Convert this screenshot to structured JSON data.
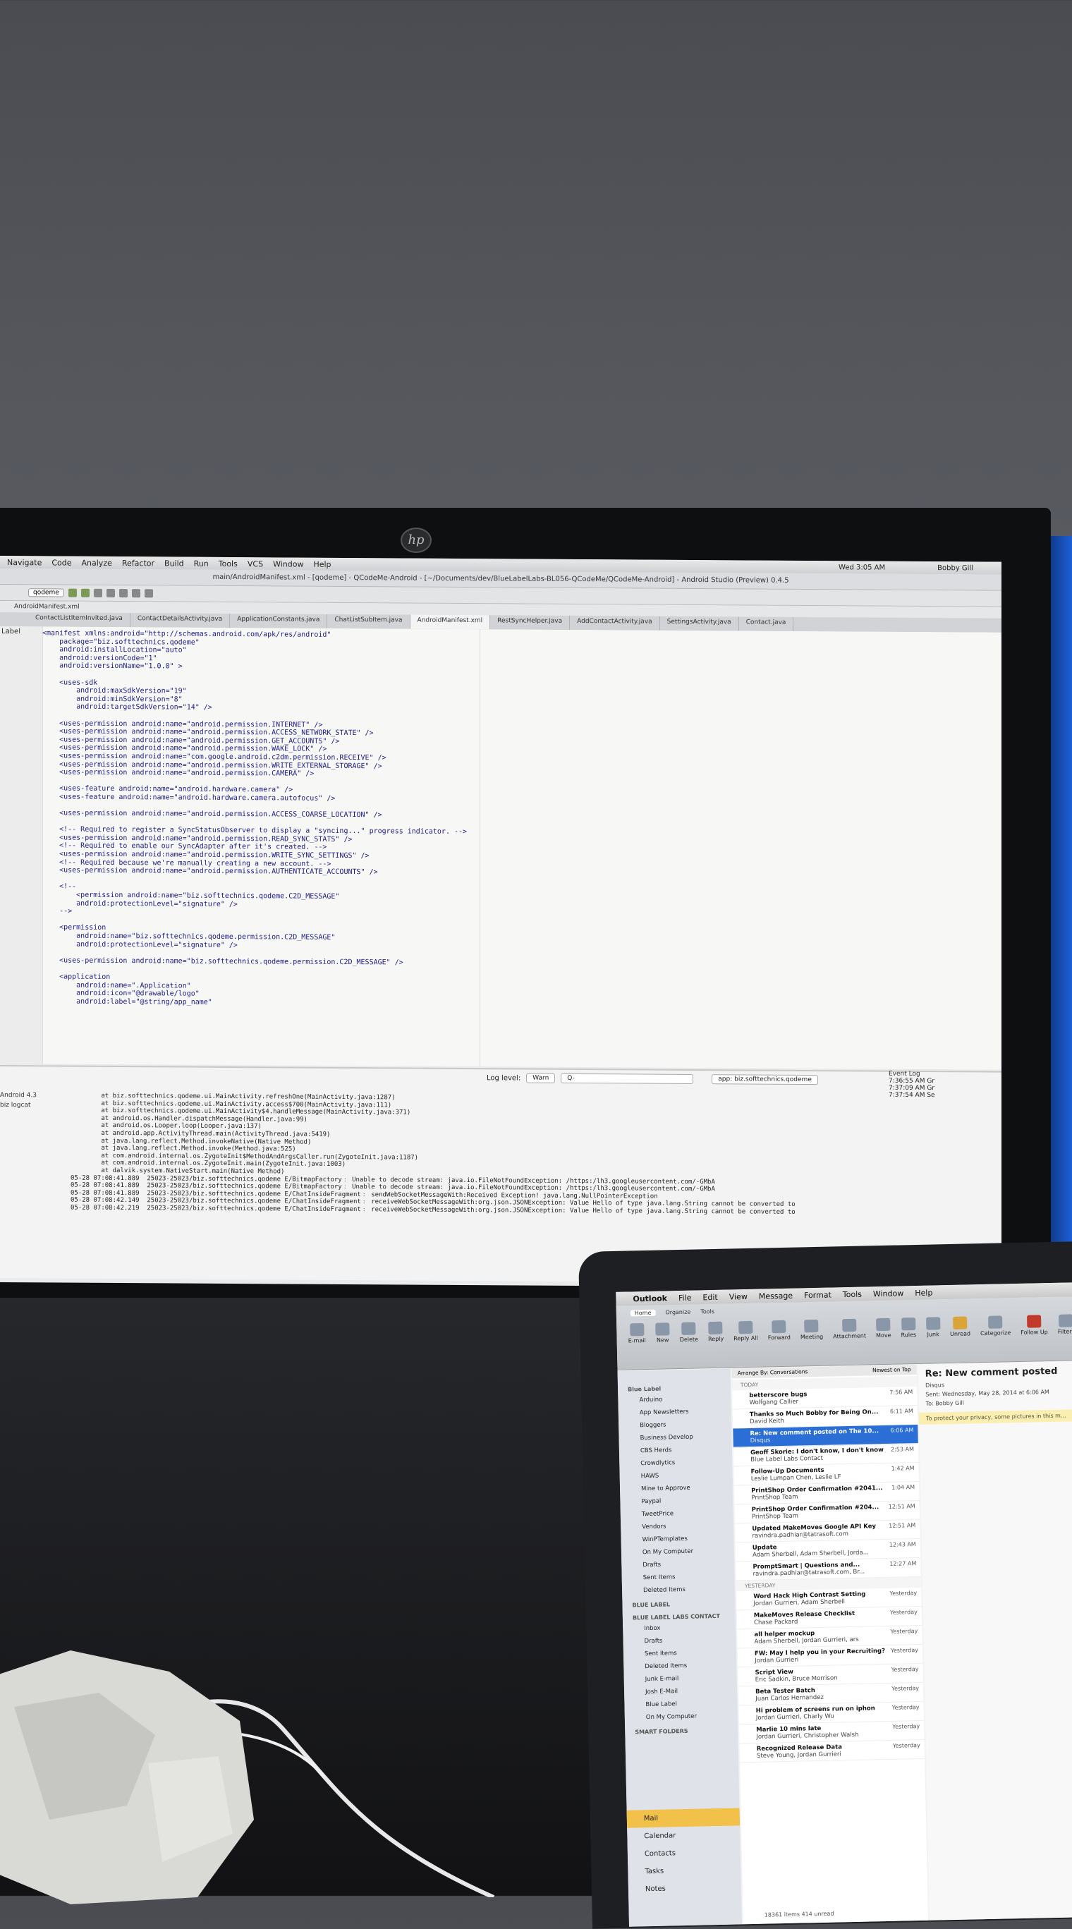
{
  "monitor": {
    "logo": "hp",
    "menubar": {
      "items": [
        "Navigate",
        "Code",
        "Analyze",
        "Refactor",
        "Build",
        "Run",
        "Tools",
        "VCS",
        "Window",
        "Help"
      ],
      "time": "Wed 3:05 AM",
      "user": "Bobby Gill"
    },
    "title": "main/AndroidManifest.xml - [qodeme] - QCodeMe-Android - [~/Documents/dev/BlueLabelLabs-BL056-QCodeMe/QCodeMe-Android] - Android Studio (Preview) 0.4.5",
    "toolbar": {
      "module": "qodeme"
    },
    "breadcrumb": "AndroidManifest.xml",
    "side_label": "Label",
    "tabs": [
      "ContactListItemInvited.java",
      "ContactDetailsActivity.java",
      "ApplicationConstants.java",
      "ChatListSubItem.java",
      "AndroidManifest.xml",
      "RestSyncHelper.java",
      "AddContactActivity.java",
      "SettingsActivity.java",
      "Contact.java"
    ],
    "code_lines": [
      "<manifest xmlns:android=\"http://schemas.android.com/apk/res/android\"",
      "    package=\"biz.softtechnics.qodeme\"",
      "    android:installLocation=\"auto\"",
      "    android:versionCode=\"1\"",
      "    android:versionName=\"1.0.0\" >",
      "",
      "    <uses-sdk",
      "        android:maxSdkVersion=\"19\"",
      "        android:minSdkVersion=\"8\"",
      "        android:targetSdkVersion=\"14\" />",
      "",
      "    <uses-permission android:name=\"android.permission.INTERNET\" />",
      "    <uses-permission android:name=\"android.permission.ACCESS_NETWORK_STATE\" />",
      "    <uses-permission android:name=\"android.permission.GET_ACCOUNTS\" />",
      "    <uses-permission android:name=\"android.permission.WAKE_LOCK\" />",
      "    <uses-permission android:name=\"com.google.android.c2dm.permission.RECEIVE\" />",
      "    <uses-permission android:name=\"android.permission.WRITE_EXTERNAL_STORAGE\" />",
      "    <uses-permission android:name=\"android.permission.CAMERA\" />",
      "",
      "    <uses-feature android:name=\"android.hardware.camera\" />",
      "    <uses-feature android:name=\"android.hardware.camera.autofocus\" />",
      "",
      "    <uses-permission android:name=\"android.permission.ACCESS_COARSE_LOCATION\" />",
      "",
      "    <!-- Required to register a SyncStatusObserver to display a \"syncing...\" progress indicator. -->",
      "    <uses-permission android:name=\"android.permission.READ_SYNC_STATS\" />",
      "    <!-- Required to enable our SyncAdapter after it's created. -->",
      "    <uses-permission android:name=\"android.permission.WRITE_SYNC_SETTINGS\" />",
      "    <!-- Required because we're manually creating a new account. -->",
      "    <uses-permission android:name=\"android.permission.AUTHENTICATE_ACCOUNTS\" />",
      "",
      "    <!--",
      "        <permission android:name=\"biz.softtechnics.qodeme.C2D_MESSAGE\"",
      "        android:protectionLevel=\"signature\" />",
      "    -->",
      "",
      "    <permission",
      "        android:name=\"biz.softtechnics.qodeme.permission.C2D_MESSAGE\"",
      "        android:protectionLevel=\"signature\" />",
      "",
      "    <uses-permission android:name=\"biz.softtechnics.qodeme.permission.C2D_MESSAGE\" />",
      "",
      "    <application",
      "        android:name=\".Application\"",
      "        android:icon=\"@drawable/logo\"",
      "        android:label=\"@string/app_name\""
    ],
    "logcat": {
      "log_level_label": "Log level:",
      "log_level": "Warn",
      "search_placeholder": "Q-",
      "app_filter": "app: biz.softtechnics.qodeme",
      "device": "Android 4.3",
      "panel_title": "biz logcat",
      "lines": [
        "        at biz.softtechnics.qodeme.ui.MainActivity.refreshOne(MainActivity.java:1287)",
        "        at biz.softtechnics.qodeme.ui.MainActivity.access$700(MainActivity.java:111)",
        "        at biz.softtechnics.qodeme.ui.MainActivity$4.handleMessage(MainActivity.java:371)",
        "        at android.os.Handler.dispatchMessage(Handler.java:99)",
        "        at android.os.Looper.loop(Looper.java:137)",
        "        at android.app.ActivityThread.main(ActivityThread.java:5419)",
        "        at java.lang.reflect.Method.invokeNative(Native Method)",
        "        at java.lang.reflect.Method.invoke(Method.java:525)",
        "        at com.android.internal.os.ZygoteInit$MethodAndArgsCaller.run(ZygoteInit.java:1187)",
        "        at com.android.internal.os.ZygoteInit.main(ZygoteInit.java:1003)",
        "        at dalvik.system.NativeStart.main(Native Method)",
        "05-28 07:08:41.889  25023-25023/biz.softtechnics.qodeme E/BitmapFactory﹕ Unable to decode stream: java.io.FileNotFoundException: /https:/lh3.googleusercontent.com/-GMbA",
        "05-28 07:08:41.889  25023-25023/biz.softtechnics.qodeme E/BitmapFactory﹕ Unable to decode stream: java.io.FileNotFoundException: /https:/lh3.googleusercontent.com/-GMbA",
        "05-28 07:08:41.889  25023-25023/biz.softtechnics.qodeme E/ChatInsideFragment﹕ sendWebSocketMessageWith:Received Exception! java.lang.NullPointerException",
        "05-28 07:08:42.149  25023-25023/biz.softtechnics.qodeme E/ChatInsideFragment﹕ receiveWebSocketMessageWith:org.json.JSONException: Value Hello of type java.lang.String cannot be converted to",
        "05-28 07:08:42.219  25023-25023/biz.softtechnics.qodeme E/ChatInsideFragment﹕ receiveWebSocketMessageWith:org.json.JSONException: Value Hello of type java.lang.String cannot be converted to"
      ]
    },
    "event_log": {
      "title": "Event Log",
      "entries": [
        "7:36:55 AM Gr",
        "7:37:09 AM Gr",
        "7:37:54 AM Se"
      ]
    }
  },
  "laptop": {
    "menu": [
      "Outlook",
      "File",
      "Edit",
      "View",
      "Message",
      "Format",
      "Tools",
      "Window",
      "Help"
    ],
    "ribbon_tabs": [
      "Home",
      "Organize",
      "Tools"
    ],
    "ribbon_buttons": [
      "E-mail",
      "New",
      "Delete",
      "Reply",
      "Reply All",
      "Forward",
      "Meeting",
      "Attachment",
      "Move",
      "Rules",
      "Junk",
      "Unread",
      "Categorize",
      "Follow Up",
      "Filters"
    ],
    "arrange_by": "Arrange By: Conversations",
    "newest": "Newest on Top",
    "folders": [
      {
        "type": "header",
        "label": "Blue Label"
      },
      {
        "type": "folder",
        "label": "Arduino"
      },
      {
        "type": "folder",
        "label": "App Newsletters"
      },
      {
        "type": "folder",
        "label": "Bloggers"
      },
      {
        "type": "folder",
        "label": "Business Develop"
      },
      {
        "type": "folder",
        "label": "CBS Herds"
      },
      {
        "type": "folder",
        "label": "Crowdlytics"
      },
      {
        "type": "folder",
        "label": "HAWS"
      },
      {
        "type": "folder",
        "label": "Mine to Approve"
      },
      {
        "type": "folder",
        "label": "Paypal"
      },
      {
        "type": "folder",
        "label": "TweetPrice"
      },
      {
        "type": "folder",
        "label": "Vendors"
      },
      {
        "type": "folder",
        "label": "WinPTemplates"
      },
      {
        "type": "folder",
        "label": "On My Computer"
      },
      {
        "type": "folder",
        "label": "Drafts"
      },
      {
        "type": "folder",
        "label": "Sent Items"
      },
      {
        "type": "folder",
        "label": "Deleted Items"
      },
      {
        "type": "header",
        "label": "BLUE LABEL"
      },
      {
        "type": "header",
        "label": "BLUE LABEL LABS CONTACT"
      },
      {
        "type": "folder",
        "label": "Inbox"
      },
      {
        "type": "folder",
        "label": "Drafts"
      },
      {
        "type": "folder",
        "label": "Sent Items"
      },
      {
        "type": "folder",
        "label": "Deleted Items"
      },
      {
        "type": "folder",
        "label": "Junk E-mail"
      },
      {
        "type": "folder",
        "label": "Josh E-Mail"
      },
      {
        "type": "folder",
        "label": "Blue Label"
      },
      {
        "type": "folder",
        "label": "On My Computer"
      },
      {
        "type": "header",
        "label": "SMART FOLDERS"
      }
    ],
    "nav": [
      "Mail",
      "Calendar",
      "Contacts",
      "Tasks",
      "Notes"
    ],
    "groups": [
      "TODAY",
      "YESTERDAY"
    ],
    "messages": [
      {
        "subject": "betterscore bugs",
        "from": "Wolfgang Callier",
        "time": "7:56 AM"
      },
      {
        "subject": "Thanks so Much Bobby for Being On...",
        "from": "David Keith",
        "time": "6:11 AM"
      },
      {
        "subject": "Re: New comment posted on The 10...",
        "from": "Disqus",
        "time": "6:06 AM",
        "selected": true
      },
      {
        "subject": "Geoff Skorie: I don't know, I don't know",
        "from": "Blue Label Labs Contact",
        "time": "2:53 AM"
      },
      {
        "subject": "Follow-Up Documents",
        "from": "Leslie Lumpan Chen, Leslie LF",
        "time": "1:42 AM"
      },
      {
        "subject": "PrintShop Order Confirmation #2041...",
        "from": "PrintShop Team",
        "time": "1:04 AM"
      },
      {
        "subject": "PrintShop Order Confirmation #204...",
        "from": "PrintShop Team",
        "time": "12:51 AM"
      },
      {
        "subject": "Updated MakeMoves Google API Key",
        "from": "ravindra.padhiar@tatrasoft.com",
        "time": "12:51 AM"
      },
      {
        "subject": "Update",
        "from": "Adam Sherbell, Adam Sherbell, Jorda...",
        "time": "12:43 AM"
      },
      {
        "subject": "PromptSmart | Questions and...",
        "from": "ravindra.padhiar@tatrasoft.com, Br...",
        "time": "12:27 AM"
      },
      {
        "subject": "Word Hack High Contrast Setting",
        "from": "Jordan Gurrieri, Adam Sherbell",
        "time": "Yesterday"
      },
      {
        "subject": "MakeMoves Release Checklist",
        "from": "Chase Packard",
        "time": "Yesterday"
      },
      {
        "subject": "all helper mockup",
        "from": "Adam Sherbell, Jordan Gurrieri, ars",
        "time": "Yesterday"
      },
      {
        "subject": "FW: May I help you in your Recruiting?",
        "from": "Jordan Gurrieri",
        "time": "Yesterday"
      },
      {
        "subject": "Script View",
        "from": "Eric Sadkin, Bruce Morrison",
        "time": "Yesterday"
      },
      {
        "subject": "Beta Tester Batch",
        "from": "Juan Carlos Hernandez",
        "time": "Yesterday"
      },
      {
        "subject": "Hi problem of screens run on iphon",
        "from": "Jordan Gurrieri, Charly Wu",
        "time": "Yesterday"
      },
      {
        "subject": "Marlie 10 mins late",
        "from": "Jordan Gurrieri, Christopher Walsh",
        "time": "Yesterday"
      },
      {
        "subject": "Recognized Release Data",
        "from": "Steve Young, Jordan Gurrieri",
        "time": "Yesterday"
      }
    ],
    "list_footer": "18361 items    414 unread",
    "reading": {
      "subject": "Re: New comment posted",
      "sender": "Disqus",
      "sent": "Sent: Wednesday, May 28, 2014 at 6:06 AM",
      "to": "To: Bobby Gill",
      "warning": "To protect your privacy, some pictures in this m..."
    }
  },
  "colors": {
    "ide_background": "#f7f7f5",
    "outlook_selection": "#2b6fd6",
    "outlook_nav_selected": "#f2c14a",
    "monitor_bezel": "#0e0f10"
  }
}
